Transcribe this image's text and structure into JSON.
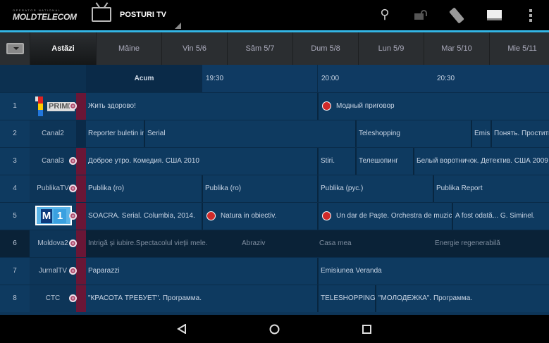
{
  "header": {
    "logo_small": "OPERATOR NATIONAL",
    "logo": "MOLDTELECOM",
    "title": "POSTURI TV"
  },
  "tabs": [
    "Astăzi",
    "Mâine",
    "Vin 5/6",
    "Sâm 5/7",
    "Dum 5/8",
    "Lun 5/9",
    "Mar 5/10",
    "Mie 5/11"
  ],
  "timeline": {
    "now": "Acum",
    "times": [
      "19:30",
      "20:00",
      "20:30"
    ]
  },
  "channels": [
    {
      "num": "1",
      "name": "",
      "logo_text": "PRIME",
      "programs": [
        {
          "title": "Жить здорово!",
          "icon": "rec"
        },
        {
          "title": "Модный приговор",
          "icon": "live"
        }
      ]
    },
    {
      "num": "2",
      "name": "Canal2",
      "programs": [
        {
          "title": "Reporter buletin informativ"
        },
        {
          "title": "Serial"
        },
        {
          "title": "Teleshopping"
        },
        {
          "title": "Emis"
        },
        {
          "title": "Понять. Простить"
        }
      ]
    },
    {
      "num": "3",
      "name": "Canal3",
      "programs": [
        {
          "title": "Доброе утро. Комедия. США 2010",
          "icon": "rec"
        },
        {
          "title": "Stiri."
        },
        {
          "title": "Телешопинг"
        },
        {
          "title": "Белый воротничок. Детектив. США 2009"
        }
      ]
    },
    {
      "num": "4",
      "name": "PublikaTV",
      "programs": [
        {
          "title": "Publika (ro)",
          "icon": "rec"
        },
        {
          "title": "Publika (ro)"
        },
        {
          "title": "Publika (рус.)"
        },
        {
          "title": "Publika Report"
        }
      ]
    },
    {
      "num": "5",
      "name": "",
      "logo_text": "M 1",
      "programs": [
        {
          "title": "SOACRA. Serial. Columbia, 2014.",
          "icon": "rec"
        },
        {
          "title": "Natura in obiectiv.",
          "icon": "live"
        },
        {
          "title": "Un dar de Paște. Orchestra de muzică",
          "icon": "live"
        },
        {
          "title": "A fost odată... G. Siminel."
        }
      ]
    },
    {
      "num": "6",
      "name": "Moldova2",
      "programs": [
        {
          "title": "Intrigă și iubire.Spectacolul vieții mele.",
          "icon": "rec"
        },
        {
          "title": "Abraziv"
        },
        {
          "title": "Casa mea"
        },
        {
          "title": "Energie regenerabilă"
        }
      ]
    },
    {
      "num": "7",
      "name": "JurnalTV",
      "programs": [
        {
          "title": "Paparazzi",
          "icon": "rec"
        },
        {
          "title": "Emisiunea Veranda"
        }
      ]
    },
    {
      "num": "8",
      "name": "CTC",
      "programs": [
        {
          "title": "\"КРАСОТА ТРЕБУЕТ\". Программа.",
          "icon": "rec"
        },
        {
          "title": "TELESHOPPING"
        },
        {
          "title": "\"МОЛОДЕЖКА\". Программа."
        }
      ]
    }
  ]
}
